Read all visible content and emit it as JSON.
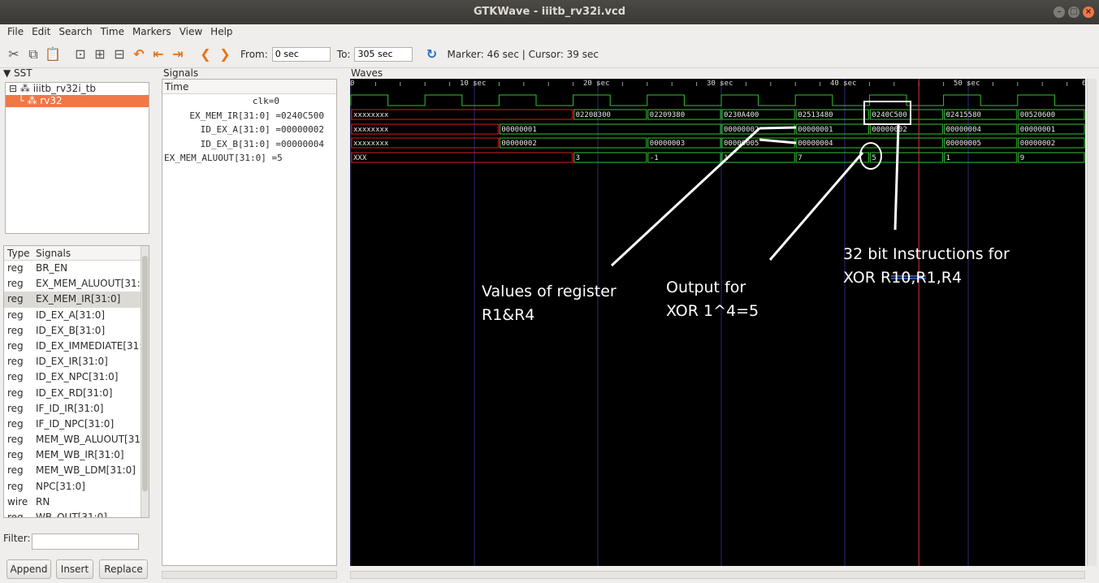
{
  "window": {
    "title": "GTKWave - iiitb_rv32i.vcd"
  },
  "menu": [
    "File",
    "Edit",
    "Search",
    "Time",
    "Markers",
    "View",
    "Help"
  ],
  "toolbar": {
    "from_label": "From:",
    "from_value": "0 sec",
    "to_label": "To:",
    "to_value": "305 sec",
    "marker_status": "Marker: 46 sec  |  Cursor: 39 sec"
  },
  "sst": {
    "label": "SST",
    "tree": [
      "iiitb_rv32i_tb",
      "rv32"
    ]
  },
  "signal_list": {
    "type_header": "Type",
    "signals_header": "Signals",
    "rows": [
      {
        "type": "reg",
        "name": "BR_EN"
      },
      {
        "type": "reg",
        "name": "EX_MEM_ALUOUT[31:0"
      },
      {
        "type": "reg",
        "name": "EX_MEM_IR[31:0]"
      },
      {
        "type": "reg",
        "name": "ID_EX_A[31:0]"
      },
      {
        "type": "reg",
        "name": "ID_EX_B[31:0]"
      },
      {
        "type": "reg",
        "name": "ID_EX_IMMEDIATE[31:0"
      },
      {
        "type": "reg",
        "name": "ID_EX_IR[31:0]"
      },
      {
        "type": "reg",
        "name": "ID_EX_NPC[31:0]"
      },
      {
        "type": "reg",
        "name": "ID_EX_RD[31:0]"
      },
      {
        "type": "reg",
        "name": "IF_ID_IR[31:0]"
      },
      {
        "type": "reg",
        "name": "IF_ID_NPC[31:0]"
      },
      {
        "type": "reg",
        "name": "MEM_WB_ALUOUT[31:"
      },
      {
        "type": "reg",
        "name": "MEM_WB_IR[31:0]"
      },
      {
        "type": "reg",
        "name": "MEM_WB_LDM[31:0]"
      },
      {
        "type": "reg",
        "name": "NPC[31:0]"
      },
      {
        "type": "wire",
        "name": "RN"
      },
      {
        "type": "reg",
        "name": "WB_OUT[31:0]"
      }
    ],
    "filter_label": "Filter:",
    "buttons": [
      "Append",
      "Insert",
      "Replace"
    ]
  },
  "signals_pane": {
    "label": "Signals",
    "time_header": "Time",
    "rows": [
      "clk=0",
      "EX_MEM_IR[31:0] =0240C500",
      "ID_EX_A[31:0] =00000002",
      "ID_EX_B[31:0] =00000004",
      "EX_MEM_ALUOUT[31:0] =5"
    ]
  },
  "waves": {
    "label": "Waves",
    "ruler": [
      "0",
      "10 sec",
      "20 sec",
      "30 sec",
      "40 sec",
      "50 sec",
      "60"
    ],
    "buses": [
      {
        "name": "EX_MEM_IR",
        "segments": [
          {
            "t0": 0,
            "t1": 18,
            "v": "xxxxxxxx",
            "x": true
          },
          {
            "t0": 18,
            "t1": 24,
            "v": "02208300"
          },
          {
            "t0": 24,
            "t1": 30,
            "v": "02209380"
          },
          {
            "t0": 30,
            "t1": 36,
            "v": "0230A400"
          },
          {
            "t0": 36,
            "t1": 42,
            "v": "02513480"
          },
          {
            "t0": 42,
            "t1": 48,
            "v": "0240C500"
          },
          {
            "t0": 48,
            "t1": 54,
            "v": "02415580"
          },
          {
            "t0": 54,
            "t1": 60,
            "v": "00520600"
          }
        ]
      },
      {
        "name": "ID_EX_A",
        "segments": [
          {
            "t0": 0,
            "t1": 12,
            "v": "xxxxxxxx",
            "x": true
          },
          {
            "t0": 12,
            "t1": 30,
            "v": "00000001"
          },
          {
            "t0": 30,
            "t1": 36,
            "v": "00000002"
          },
          {
            "t0": 36,
            "t1": 42,
            "v": "00000001"
          },
          {
            "t0": 42,
            "t1": 48,
            "v": "00000002"
          },
          {
            "t0": 48,
            "t1": 54,
            "v": "00000004"
          },
          {
            "t0": 54,
            "t1": 60,
            "v": "00000001"
          }
        ]
      },
      {
        "name": "ID_EX_B",
        "segments": [
          {
            "t0": 0,
            "t1": 12,
            "v": "xxxxxxxx",
            "x": true
          },
          {
            "t0": 12,
            "t1": 24,
            "v": "00000002"
          },
          {
            "t0": 24,
            "t1": 30,
            "v": "00000003"
          },
          {
            "t0": 30,
            "t1": 36,
            "v": "00000005"
          },
          {
            "t0": 36,
            "t1": 48,
            "v": "00000004"
          },
          {
            "t0": 48,
            "t1": 54,
            "v": "00000005"
          },
          {
            "t0": 54,
            "t1": 60,
            "v": "00000002"
          }
        ]
      },
      {
        "name": "EX_MEM_ALUOUT",
        "segments": [
          {
            "t0": 0,
            "t1": 18,
            "v": "XXX",
            "x": true
          },
          {
            "t0": 18,
            "t1": 24,
            "v": "3"
          },
          {
            "t0": 24,
            "t1": 30,
            "v": "-1"
          },
          {
            "t0": 30,
            "t1": 36,
            "v": "1"
          },
          {
            "t0": 36,
            "t1": 42,
            "v": "7"
          },
          {
            "t0": 42,
            "t1": 48,
            "v": "5"
          },
          {
            "t0": 48,
            "t1": 54,
            "v": "1"
          },
          {
            "t0": 54,
            "t1": 60,
            "v": "9"
          }
        ]
      }
    ],
    "cursor_time": 46
  },
  "annotations": {
    "registers": "Values of register\nR1&R4",
    "output": "Output for\nXOR 1^4=5",
    "instruction": "32 bit Instructions for\nXOR R10,R1,R4"
  }
}
